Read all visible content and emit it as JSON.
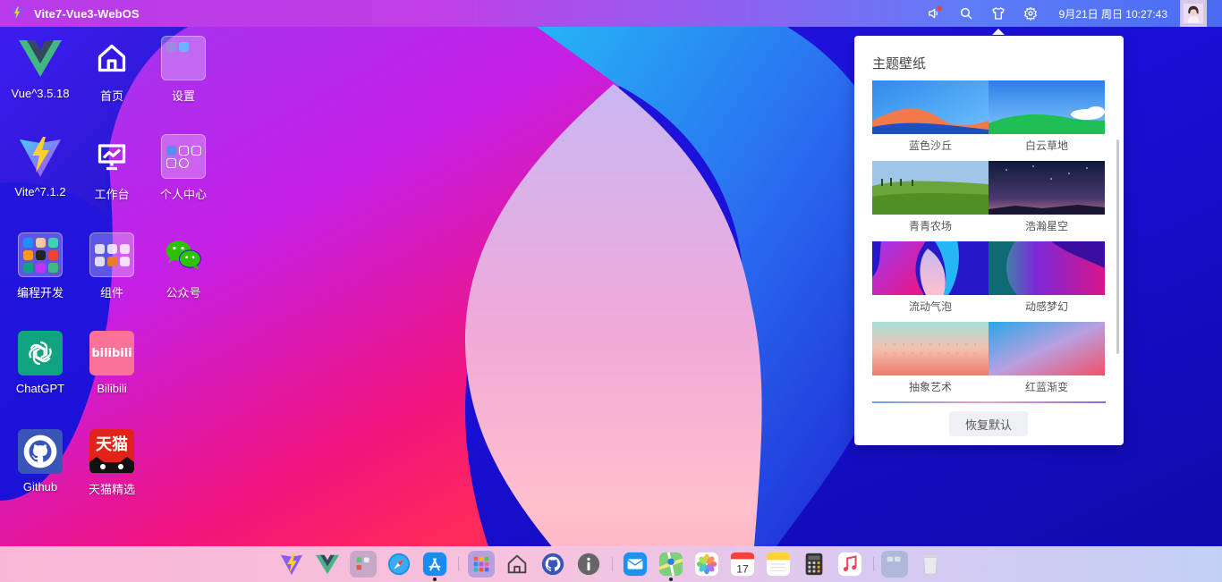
{
  "topbar": {
    "title": "Vite7-Vue3-WebOS",
    "datetime": "9月21日 周日 10:27:43"
  },
  "desktop": {
    "icons": [
      {
        "label": "Vue^3.5.18"
      },
      {
        "label": "首页"
      },
      {
        "label": "设置"
      },
      {
        "label": "Vite^7.1.2"
      },
      {
        "label": "工作台"
      },
      {
        "label": "个人中心"
      },
      {
        "label": "编程开发"
      },
      {
        "label": "组件"
      },
      {
        "label": "公众号"
      },
      {
        "label": "ChatGPT"
      },
      {
        "label": "Bilibili"
      },
      {
        "label": "Github"
      },
      {
        "label": "天猫精选"
      }
    ]
  },
  "wallpaper_panel": {
    "title": "主题壁纸",
    "items": [
      {
        "label": "蓝色沙丘"
      },
      {
        "label": "白云草地"
      },
      {
        "label": "青青农场"
      },
      {
        "label": "浩瀚星空"
      },
      {
        "label": "流动气泡"
      },
      {
        "label": "动感梦幻"
      },
      {
        "label": "抽象艺术"
      },
      {
        "label": "红蓝渐变"
      }
    ],
    "reset_label": "恢复默认"
  },
  "icon_text": {
    "bilibili": "bilibili",
    "tmall": "天猫",
    "calendar_day": "17"
  },
  "dock": {
    "items": [
      "vite-icon",
      "vue-icon",
      "folder-icon",
      "safari-icon",
      "appstore-icon",
      "launchpad-icon",
      "home-icon",
      "github-icon",
      "info-icon",
      "mail-icon",
      "maps-icon",
      "photos-icon",
      "calendar-icon",
      "notes-icon",
      "calculator-icon",
      "music-icon",
      "folder-icon",
      "trash-icon"
    ]
  },
  "colors": {
    "accent": "#4a6cf3",
    "topbar_start": "#b83ae8",
    "dock_start": "#f8b7d6"
  }
}
